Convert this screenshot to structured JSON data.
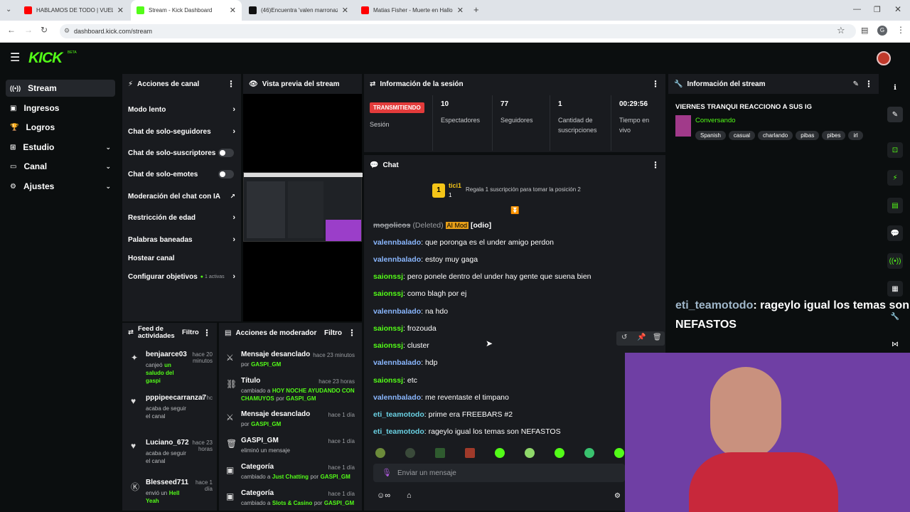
{
  "browser": {
    "tabs": [
      {
        "label": "HABLAMOS DE TODO | VUELTA",
        "color": "#ff0000"
      },
      {
        "label": "Stream - Kick Dashboard",
        "color": "#53fc18"
      },
      {
        "label": "(46)Encuentra 'valen marronaz",
        "color": "#111111"
      },
      {
        "label": "Matias Fisher - Muerte en Hallo",
        "color": "#ff0000"
      }
    ],
    "url": "dashboard.kick.com/stream",
    "profile_initial": "G"
  },
  "brand": {
    "logo": "KICK",
    "beta": "BETA",
    "accent": "#53fc18"
  },
  "sidebar": {
    "items": [
      {
        "label": "Stream",
        "icon": "stream-icon"
      },
      {
        "label": "Ingresos",
        "icon": "income-icon"
      },
      {
        "label": "Logros",
        "icon": "trophy-icon"
      },
      {
        "label": "Estudio",
        "icon": "studio-icon"
      },
      {
        "label": "Canal",
        "icon": "channel-icon"
      },
      {
        "label": "Ajustes",
        "icon": "gear-icon"
      }
    ]
  },
  "channel_actions": {
    "title": "Acciones de canal",
    "items": [
      "Modo lento",
      "Chat de solo-seguidores",
      "Chat de solo-suscriptores",
      "Chat de solo-emotes",
      "Moderación del chat con IA",
      "Restricción de edad",
      "Palabras baneadas",
      "Hostear canal",
      "Configurar objetivos"
    ],
    "goals_badge": "1 activas"
  },
  "preview": {
    "title": "Vista previa del stream"
  },
  "session": {
    "title": "Información de la sesión",
    "live_badge": "TRANSMITIENDO",
    "session_label": "Sesión",
    "stats": [
      {
        "value": "10",
        "label": "Espectadores"
      },
      {
        "value": "77",
        "label": "Seguidores"
      },
      {
        "value": "1",
        "label": "Cantidad de suscripciones"
      },
      {
        "value": "00:29:56",
        "label": "Tiempo en vivo"
      }
    ]
  },
  "stream_info": {
    "title": "Información del stream",
    "stream_title": "VIERNES TRANQUI REACCIONO A SUS IG",
    "category": "Conversando",
    "tags": [
      "Spanish",
      "casual",
      "charlando",
      "pibas",
      "pibes",
      "irl"
    ]
  },
  "chat": {
    "title": "Chat",
    "pinned_user": "tici1",
    "pinned_count": "1",
    "gift_text": "Regala 1 suscripción para tomar la posición 2",
    "deleted_user": "mogolicos",
    "deleted_label": "(Deleted)",
    "aimod_label": "AI Mod",
    "odio_label": "[odio]",
    "messages": [
      {
        "user": "valennbalado",
        "text": "que poronga es el under amigo perdon"
      },
      {
        "user": "valennbalado",
        "text": "estoy muy gaga"
      },
      {
        "user": "saionssj",
        "text": "pero ponele dentro del under hay gente que suena bien"
      },
      {
        "user": "saionssj",
        "text": "como blagh por ej"
      },
      {
        "user": "valennbalado",
        "text": "na hdo"
      },
      {
        "user": "saionssj",
        "text": "frozouda"
      },
      {
        "user": "saionssj",
        "text": "cluster"
      },
      {
        "user": "valennbalado",
        "text": "hdp"
      },
      {
        "user": "saionssj",
        "text": "etc"
      },
      {
        "user": "valennbalado",
        "text": "me reventaste el timpano"
      },
      {
        "user": "eti_teamotodo",
        "text": "prime era FREEBARS #2"
      },
      {
        "user": "eti_teamotodo",
        "text": "rageylo igual los temas son NEFASTOS"
      }
    ],
    "input_placeholder": "Enviar un mensaje"
  },
  "overlay": {
    "user": "eti_teamotodo",
    "text": ": rageylo igual los temas son NEFASTOS"
  },
  "activity": {
    "title": "Feed de actividades",
    "filter": "Filtro",
    "items": [
      {
        "user": "benjaarce03",
        "time": "hace 20 minutos",
        "line1": "canjeó",
        "gift": "un saludo del gaspi",
        "icon": "redeem-icon"
      },
      {
        "user": "pppipeecarranza7",
        "time": "h hc",
        "line1": "acaba de seguir el canal",
        "gift": "",
        "icon": "heart-icon"
      },
      {
        "user": "Luciano_672",
        "time": "hace 23 horas",
        "line1": "acaba de seguir el canal",
        "gift": "",
        "icon": "heart-icon"
      },
      {
        "user": "Blesseed711",
        "time": "hace 1 día",
        "line1": "envió un",
        "gift": "Hell Yeah",
        "icon": "kick-icon"
      }
    ]
  },
  "modactions": {
    "title": "Acciones de moderador",
    "filter": "Filtro",
    "items": [
      {
        "title": "Mensaje desanclado",
        "time": "hace 23 minutos",
        "sub": "por",
        "who": "GASPI_GM",
        "icon": "unpin-icon"
      },
      {
        "title": "Título",
        "time": "hace 23 horas",
        "sub": "cambiado a",
        "extra": "HOY NOCHE AYUDANDO CON CHAMUYOS",
        "tail": "por",
        "who": "GASPI_GM",
        "icon": "title-icon"
      },
      {
        "title": "Mensaje desanclado",
        "time": "hace 1 día",
        "sub": "por",
        "who": "GASPI_GM",
        "icon": "unpin-icon"
      },
      {
        "title": "GASPI_GM",
        "time": "hace 1 día",
        "sub": "eliminó un mensaje",
        "who": "",
        "icon": "trash-icon"
      },
      {
        "title": "Categoría",
        "time": "hace 1 día",
        "sub": "cambiado a",
        "extra": "Just Chatting",
        "tail": "por",
        "who": "GASPI_GM",
        "icon": "category-icon"
      },
      {
        "title": "Categoría",
        "time": "hace 1 día",
        "sub": "cambiado a",
        "extra": "Slots & Casino",
        "tail": "por",
        "who": "GASPI_GM",
        "icon": "category-icon"
      }
    ]
  }
}
